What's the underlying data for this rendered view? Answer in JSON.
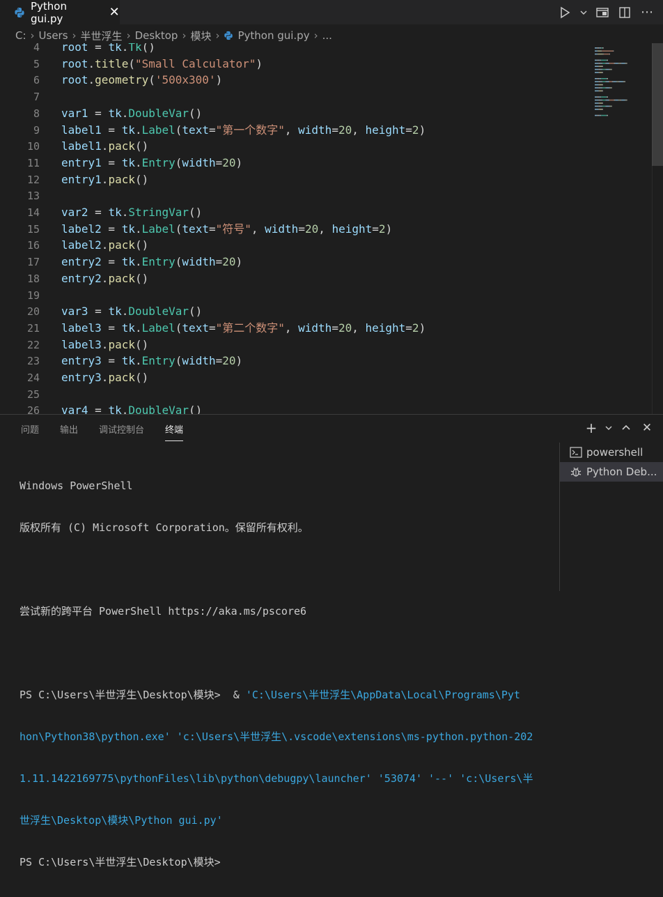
{
  "tab": {
    "label": "Python gui.py"
  },
  "breadcrumb": [
    "C:",
    "Users",
    "半世浮生",
    "Desktop",
    "模块",
    "Python gui.py",
    "..."
  ],
  "editor": {
    "lines": [
      {
        "n": "4",
        "tokens": [
          [
            "v",
            "root"
          ],
          [
            "op",
            " = "
          ],
          [
            "v",
            "tk"
          ],
          [
            "op",
            "."
          ],
          [
            "cls",
            "Tk"
          ],
          [
            "op",
            "()"
          ]
        ]
      },
      {
        "n": "5",
        "tokens": [
          [
            "v",
            "root"
          ],
          [
            "op",
            "."
          ],
          [
            "fn",
            "title"
          ],
          [
            "op",
            "("
          ],
          [
            "str",
            "\"Small Calculator\""
          ],
          [
            "op",
            ")"
          ]
        ]
      },
      {
        "n": "6",
        "tokens": [
          [
            "v",
            "root"
          ],
          [
            "op",
            "."
          ],
          [
            "fn",
            "geometry"
          ],
          [
            "op",
            "("
          ],
          [
            "str",
            "'500x300'"
          ],
          [
            "op",
            ")"
          ]
        ]
      },
      {
        "n": "7",
        "tokens": []
      },
      {
        "n": "8",
        "tokens": [
          [
            "v",
            "var1"
          ],
          [
            "op",
            " = "
          ],
          [
            "v",
            "tk"
          ],
          [
            "op",
            "."
          ],
          [
            "cls",
            "DoubleVar"
          ],
          [
            "op",
            "()"
          ]
        ]
      },
      {
        "n": "9",
        "tokens": [
          [
            "v",
            "label1"
          ],
          [
            "op",
            " = "
          ],
          [
            "v",
            "tk"
          ],
          [
            "op",
            "."
          ],
          [
            "cls",
            "Label"
          ],
          [
            "op",
            "("
          ],
          [
            "v",
            "text"
          ],
          [
            "op",
            "="
          ],
          [
            "str",
            "\"第一个数字\""
          ],
          [
            "op",
            ", "
          ],
          [
            "v",
            "width"
          ],
          [
            "op",
            "="
          ],
          [
            "num",
            "20"
          ],
          [
            "op",
            ", "
          ],
          [
            "v",
            "height"
          ],
          [
            "op",
            "="
          ],
          [
            "num",
            "2"
          ],
          [
            "op",
            ")"
          ]
        ]
      },
      {
        "n": "10",
        "tokens": [
          [
            "v",
            "label1"
          ],
          [
            "op",
            "."
          ],
          [
            "fn",
            "pack"
          ],
          [
            "op",
            "()"
          ]
        ]
      },
      {
        "n": "11",
        "tokens": [
          [
            "v",
            "entry1"
          ],
          [
            "op",
            " = "
          ],
          [
            "v",
            "tk"
          ],
          [
            "op",
            "."
          ],
          [
            "cls",
            "Entry"
          ],
          [
            "op",
            "("
          ],
          [
            "v",
            "width"
          ],
          [
            "op",
            "="
          ],
          [
            "num",
            "20"
          ],
          [
            "op",
            ")"
          ]
        ]
      },
      {
        "n": "12",
        "tokens": [
          [
            "v",
            "entry1"
          ],
          [
            "op",
            "."
          ],
          [
            "fn",
            "pack"
          ],
          [
            "op",
            "()"
          ]
        ]
      },
      {
        "n": "13",
        "tokens": []
      },
      {
        "n": "14",
        "tokens": [
          [
            "v",
            "var2"
          ],
          [
            "op",
            " = "
          ],
          [
            "v",
            "tk"
          ],
          [
            "op",
            "."
          ],
          [
            "cls",
            "StringVar"
          ],
          [
            "op",
            "()"
          ]
        ]
      },
      {
        "n": "15",
        "tokens": [
          [
            "v",
            "label2"
          ],
          [
            "op",
            " = "
          ],
          [
            "v",
            "tk"
          ],
          [
            "op",
            "."
          ],
          [
            "cls",
            "Label"
          ],
          [
            "op",
            "("
          ],
          [
            "v",
            "text"
          ],
          [
            "op",
            "="
          ],
          [
            "str",
            "\"符号\""
          ],
          [
            "op",
            ", "
          ],
          [
            "v",
            "width"
          ],
          [
            "op",
            "="
          ],
          [
            "num",
            "20"
          ],
          [
            "op",
            ", "
          ],
          [
            "v",
            "height"
          ],
          [
            "op",
            "="
          ],
          [
            "num",
            "2"
          ],
          [
            "op",
            ")"
          ]
        ]
      },
      {
        "n": "16",
        "tokens": [
          [
            "v",
            "label2"
          ],
          [
            "op",
            "."
          ],
          [
            "fn",
            "pack"
          ],
          [
            "op",
            "()"
          ]
        ]
      },
      {
        "n": "17",
        "tokens": [
          [
            "v",
            "entry2"
          ],
          [
            "op",
            " = "
          ],
          [
            "v",
            "tk"
          ],
          [
            "op",
            "."
          ],
          [
            "cls",
            "Entry"
          ],
          [
            "op",
            "("
          ],
          [
            "v",
            "width"
          ],
          [
            "op",
            "="
          ],
          [
            "num",
            "20"
          ],
          [
            "op",
            ")"
          ]
        ]
      },
      {
        "n": "18",
        "tokens": [
          [
            "v",
            "entry2"
          ],
          [
            "op",
            "."
          ],
          [
            "fn",
            "pack"
          ],
          [
            "op",
            "()"
          ]
        ]
      },
      {
        "n": "19",
        "tokens": []
      },
      {
        "n": "20",
        "tokens": [
          [
            "v",
            "var3"
          ],
          [
            "op",
            " = "
          ],
          [
            "v",
            "tk"
          ],
          [
            "op",
            "."
          ],
          [
            "cls",
            "DoubleVar"
          ],
          [
            "op",
            "()"
          ]
        ]
      },
      {
        "n": "21",
        "tokens": [
          [
            "v",
            "label3"
          ],
          [
            "op",
            " = "
          ],
          [
            "v",
            "tk"
          ],
          [
            "op",
            "."
          ],
          [
            "cls",
            "Label"
          ],
          [
            "op",
            "("
          ],
          [
            "v",
            "text"
          ],
          [
            "op",
            "="
          ],
          [
            "str",
            "\"第二个数字\""
          ],
          [
            "op",
            ", "
          ],
          [
            "v",
            "width"
          ],
          [
            "op",
            "="
          ],
          [
            "num",
            "20"
          ],
          [
            "op",
            ", "
          ],
          [
            "v",
            "height"
          ],
          [
            "op",
            "="
          ],
          [
            "num",
            "2"
          ],
          [
            "op",
            ")"
          ]
        ]
      },
      {
        "n": "22",
        "tokens": [
          [
            "v",
            "label3"
          ],
          [
            "op",
            "."
          ],
          [
            "fn",
            "pack"
          ],
          [
            "op",
            "()"
          ]
        ]
      },
      {
        "n": "23",
        "tokens": [
          [
            "v",
            "entry3"
          ],
          [
            "op",
            " = "
          ],
          [
            "v",
            "tk"
          ],
          [
            "op",
            "."
          ],
          [
            "cls",
            "Entry"
          ],
          [
            "op",
            "("
          ],
          [
            "v",
            "width"
          ],
          [
            "op",
            "="
          ],
          [
            "num",
            "20"
          ],
          [
            "op",
            ")"
          ]
        ]
      },
      {
        "n": "24",
        "tokens": [
          [
            "v",
            "entry3"
          ],
          [
            "op",
            "."
          ],
          [
            "fn",
            "pack"
          ],
          [
            "op",
            "()"
          ]
        ]
      },
      {
        "n": "25",
        "tokens": []
      },
      {
        "n": "26",
        "tokens": [
          [
            "v",
            "var4"
          ],
          [
            "op",
            " = "
          ],
          [
            "v",
            "tk"
          ],
          [
            "op",
            "."
          ],
          [
            "cls",
            "DoubleVar"
          ],
          [
            "op",
            "()"
          ]
        ]
      }
    ]
  },
  "panel": {
    "tabs": [
      "问题",
      "输出",
      "调试控制台",
      "终端"
    ],
    "active_tab": "终端",
    "terminal_lines": [
      {
        "text": "Windows PowerShell",
        "cls": ""
      },
      {
        "text": "版权所有 (C) Microsoft Corporation。保留所有权利。",
        "cls": ""
      },
      {
        "text": "",
        "cls": ""
      },
      {
        "text": "尝试新的跨平台 PowerShell https://aka.ms/pscore6",
        "cls": ""
      },
      {
        "text": "",
        "cls": ""
      }
    ],
    "prompt1": "PS C:\\Users\\半世浮生\\Desktop\\模块>",
    "command_amp": "  & ",
    "command_rest_lines": [
      "'C:\\Users\\半世浮生\\AppData\\Local\\Programs\\Pyt",
      "hon\\Python38\\python.exe' 'c:\\Users\\半世浮生\\.vscode\\extensions\\ms-python.python-202",
      "1.11.1422169775\\pythonFiles\\lib\\python\\debugpy\\launcher' '53074' '--' 'c:\\Users\\半",
      "世浮生\\Desktop\\模块\\Python gui.py'"
    ],
    "prompt2": "PS C:\\Users\\半世浮生\\Desktop\\模块>",
    "terminals": [
      {
        "label": "powershell",
        "icon": "terminal-icon"
      },
      {
        "label": "Python Deb...",
        "icon": "debug-icon"
      }
    ]
  }
}
